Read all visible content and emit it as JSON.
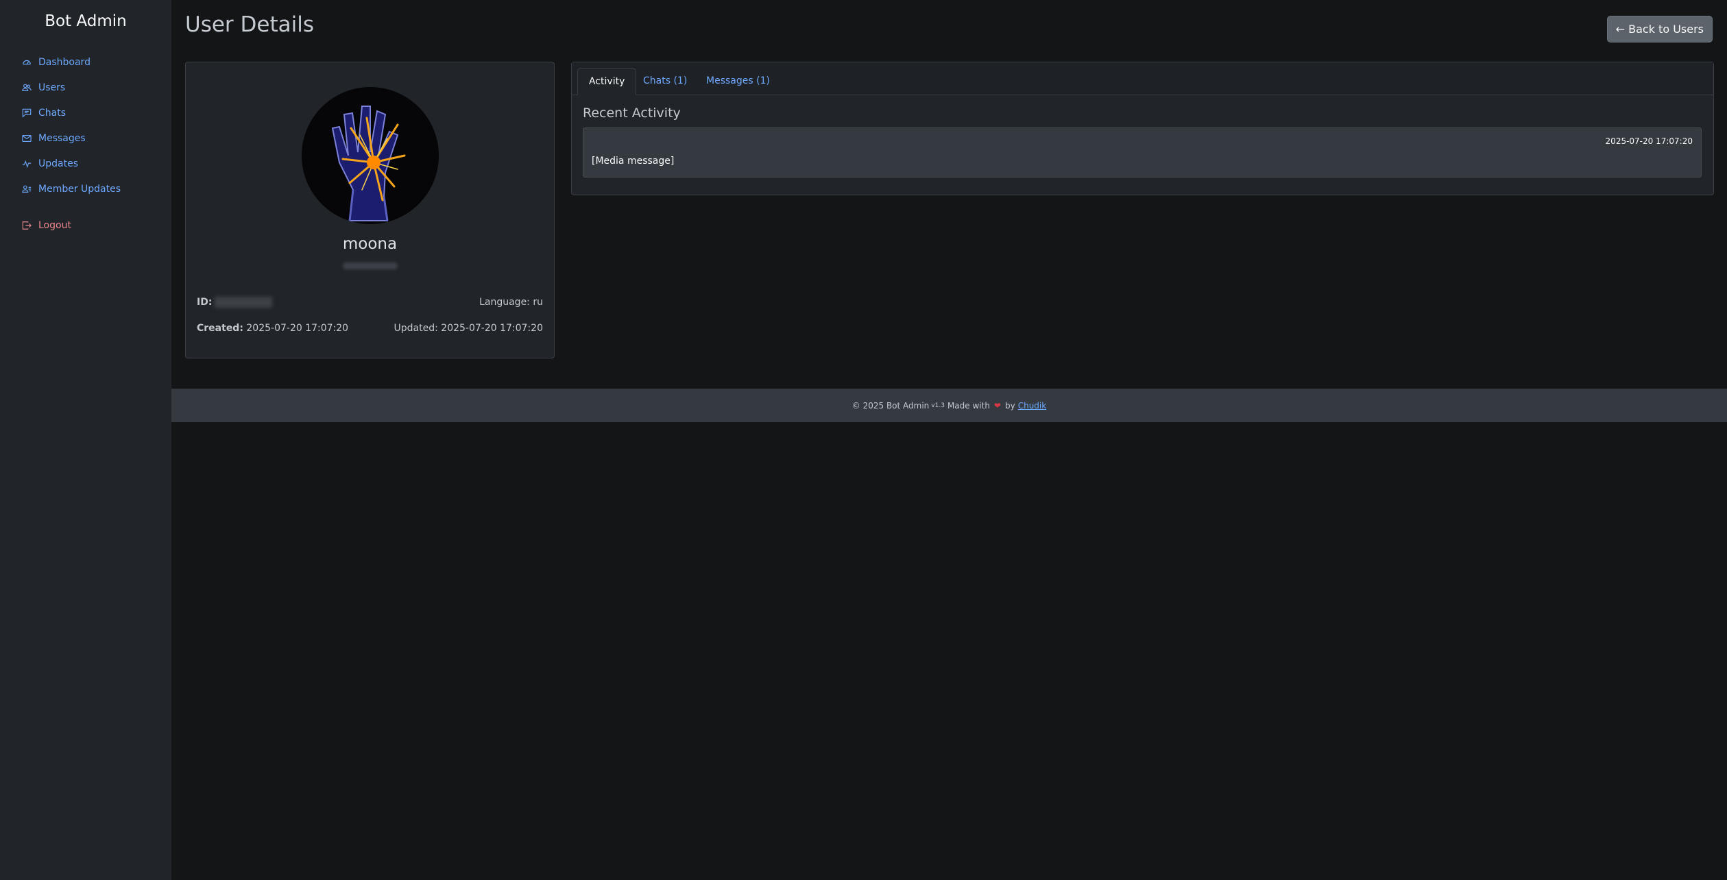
{
  "sidebar": {
    "brand": "Bot Admin",
    "items": [
      {
        "label": "Dashboard",
        "icon": "speedometer-icon"
      },
      {
        "label": "Users",
        "icon": "people-icon"
      },
      {
        "label": "Chats",
        "icon": "chat-icon"
      },
      {
        "label": "Messages",
        "icon": "envelope-icon"
      },
      {
        "label": "Updates",
        "icon": "activity-icon"
      },
      {
        "label": "Member Updates",
        "icon": "person-lines-icon"
      }
    ],
    "logout": {
      "label": "Logout",
      "icon": "box-arrow-right-icon"
    }
  },
  "header": {
    "title": "User Details",
    "back_button": "← Back to Users"
  },
  "profile": {
    "name": "moona",
    "id_label": "ID:",
    "language_label": "Language:",
    "language": "ru",
    "created_label": "Created:",
    "created": "2025-07-20 17:07:20",
    "updated_label": "Updated:",
    "updated": "2025-07-20 17:07:20"
  },
  "tabs": [
    {
      "label": "Activity",
      "active": true
    },
    {
      "label": "Chats (1)",
      "active": false
    },
    {
      "label": "Messages (1)",
      "active": false
    }
  ],
  "activity": {
    "title": "Recent Activity",
    "items": [
      {
        "time": "2025-07-20 17:07:20",
        "text": "[Media message]"
      }
    ]
  },
  "footer": {
    "copyright": "© 2025 Bot Admin",
    "version": "v1.3",
    "made_with": "Made with",
    "by": "by",
    "author": "Chudik"
  },
  "colors": {
    "accent": "#6ea8fe",
    "danger": "#ea868f",
    "background": "#131517",
    "sidebar": "#212529"
  }
}
